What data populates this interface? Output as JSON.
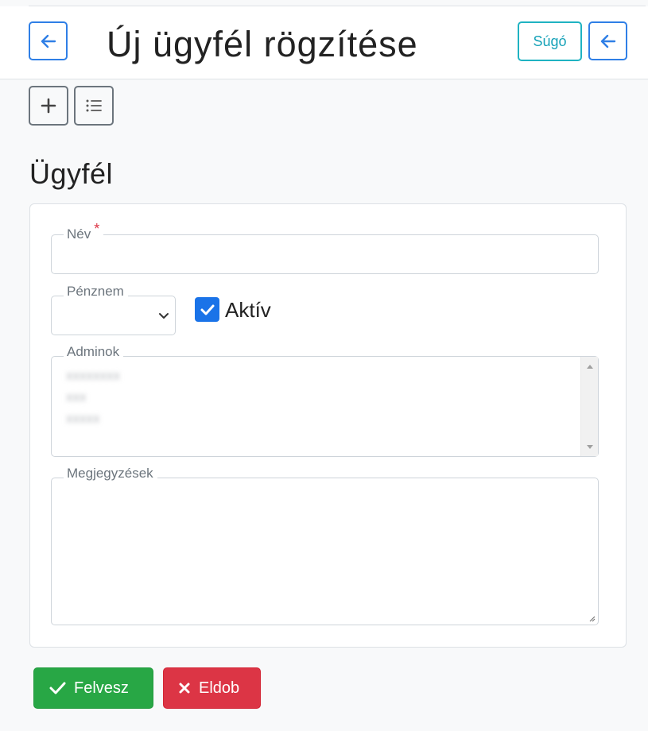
{
  "header": {
    "title": "Új ügyfél rögzítése",
    "help_label": "Súgó",
    "back_icon": "arrow-left-icon"
  },
  "toolbar": {
    "add_icon": "plus-icon",
    "list_icon": "list-icon"
  },
  "section": {
    "title": "Ügyfél"
  },
  "form": {
    "name": {
      "label": "Név",
      "required_mark": "*",
      "value": ""
    },
    "currency": {
      "label": "Pénznem",
      "selected": ""
    },
    "active": {
      "label": "Aktív",
      "checked": true
    },
    "admins": {
      "label": "Adminok",
      "options": [
        "xxxxxxxx",
        "xxx",
        "xxxxx"
      ]
    },
    "notes": {
      "label": "Megjegyzések",
      "value": ""
    }
  },
  "actions": {
    "save_label": "Felvesz",
    "discard_label": "Eldob"
  },
  "colors": {
    "primary": "#2f7fe6",
    "info": "#17a2b8",
    "success": "#28a745",
    "danger": "#dc3545",
    "checkbox": "#1a73e8"
  }
}
